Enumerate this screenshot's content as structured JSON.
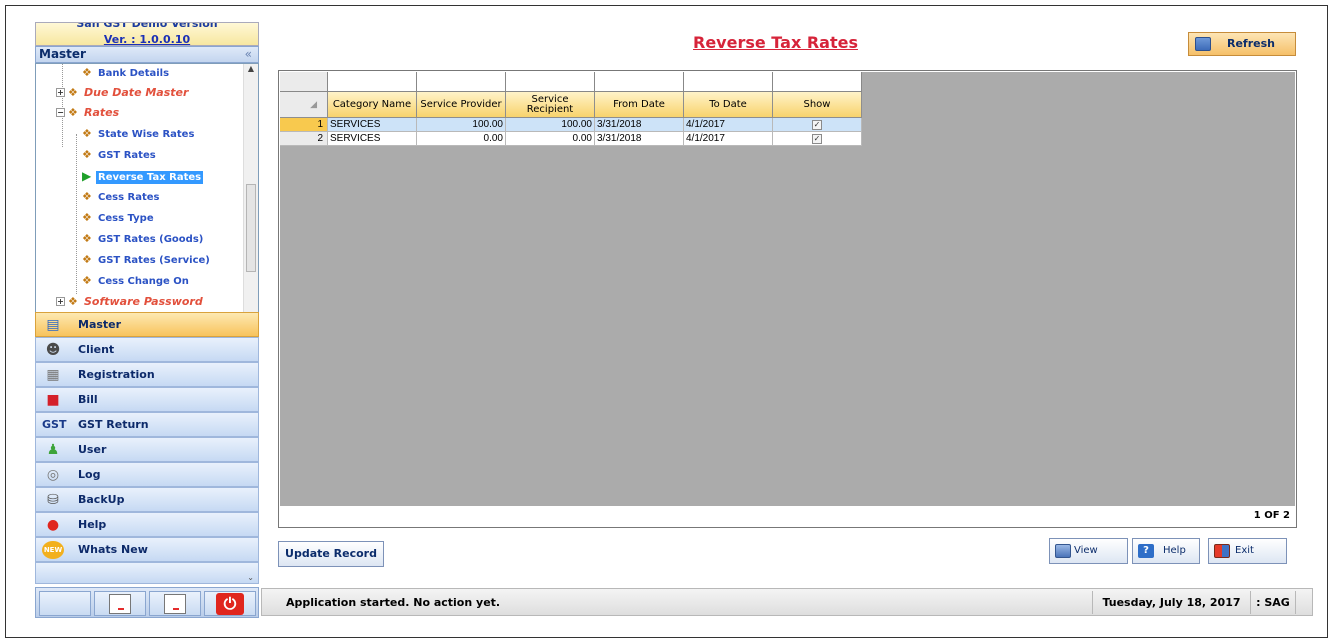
{
  "app": {
    "version_top": "Sah GST Demo Version",
    "version": "Ver. : 1.0.0.10"
  },
  "sidebar": {
    "header": "Master",
    "collapse_icon": "double-chevron-left-icon",
    "tree": {
      "bank_details": "Bank Details",
      "due_date_master": "Due Date Master",
      "rates": "Rates",
      "state_wise_rates": "State Wise Rates",
      "gst_rates": "GST Rates",
      "reverse_tax_rates": "Reverse Tax Rates",
      "cess_rates": "Cess Rates",
      "cess_type": "Cess Type",
      "gst_rates_goods": "GST Rates (Goods)",
      "gst_rates_service": "GST Rates (Service)",
      "cess_change_on": "Cess Change On",
      "software_password": "Software Password"
    },
    "nav": {
      "master": "Master",
      "client": "Client",
      "registration": "Registration",
      "bill": "Bill",
      "gst_return": "GST Return",
      "gst_return_icon_text": "GST",
      "user": "User",
      "log": "Log",
      "backup": "BackUp",
      "help": "Help",
      "whats_new": "Whats New",
      "whats_new_badge": "NEW"
    }
  },
  "main": {
    "title": "Reverse Tax Rates",
    "refresh_label": "Refresh",
    "grid": {
      "columns": [
        "Category Name",
        "Service Provider",
        "Service Recipient",
        "From Date",
        "To Date",
        "Show"
      ],
      "rows": [
        {
          "num": "1",
          "category": "SERVICES",
          "provider": "100.00",
          "recipient": "100.00",
          "from": "3/31/2018",
          "to": "4/1/2017",
          "show": true
        },
        {
          "num": "2",
          "category": "SERVICES",
          "provider": "0.00",
          "recipient": "0.00",
          "from": "3/31/2018",
          "to": "4/1/2017",
          "show": true
        }
      ],
      "pager": "1 OF 2"
    },
    "buttons": {
      "update_record": "Update Record",
      "view": "View",
      "help": "Help",
      "exit": "Exit"
    }
  },
  "status": {
    "message": "Application started. No action yet.",
    "date": "Tuesday, July 18, 2017",
    "user": ": SAG"
  },
  "colors": {
    "title": "#d6243a",
    "selected_tree": "#3399ff",
    "nav_active": "#f8c35c",
    "header_gold": "#f8d36c",
    "grid_bg": "#ababab"
  }
}
